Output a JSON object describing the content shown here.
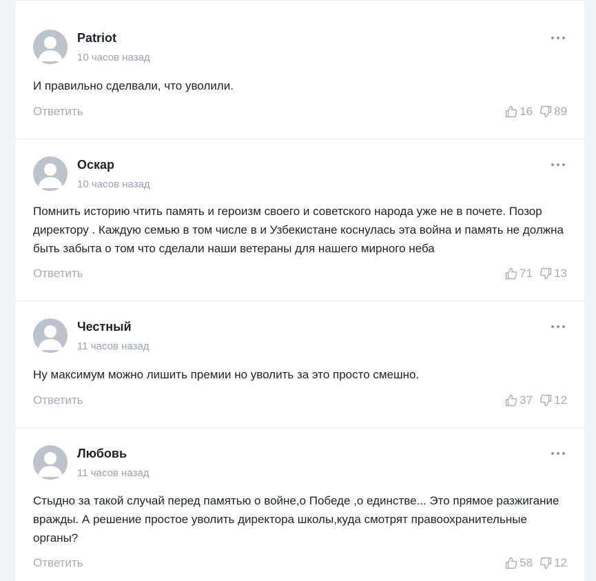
{
  "comments": [
    {
      "author": "Patriot",
      "time": "10 часов назад",
      "text": "И правильно сделвали, что уволили.",
      "reply_label": "Ответить",
      "likes": "16",
      "dislikes": "89"
    },
    {
      "author": "Оскар",
      "time": "10 часов назад",
      "text": "Помнить историю чтить память и героизм своего и советского народа уже не в почете. Позор директору . Каждую семью в том числе в и Узбекистане коснулась эта война и память не должна быть забыта о том что сделали наши ветераны для нашего мирного неба",
      "reply_label": "Ответить",
      "likes": "71",
      "dislikes": "13"
    },
    {
      "author": "Честный",
      "time": "11 часов назад",
      "text": "Ну максимум можно лишить премии но уволить за это просто смешно.",
      "reply_label": "Ответить",
      "likes": "37",
      "dislikes": "12"
    },
    {
      "author": "Любовь",
      "time": "11 часов назад",
      "text": "Стыдно за такой случай перед памятью о войне,о Победе ,о единстве... Это прямое разжигание вражды. А решение простое уволить директора школы,куда смотрят правоохранительные органы?",
      "reply_label": "Ответить",
      "likes": "58",
      "dislikes": "12"
    }
  ],
  "icons": {
    "avatar": "user-silhouette-icon",
    "more": "more-dots-icon",
    "like": "thumbs-up-icon",
    "dislike": "thumbs-down-icon"
  },
  "colors": {
    "background": "#f2f3f5",
    "card": "#ffffff",
    "text": "#1f2329",
    "muted": "#9aa1ab",
    "avatar": "#bdc3cc"
  }
}
